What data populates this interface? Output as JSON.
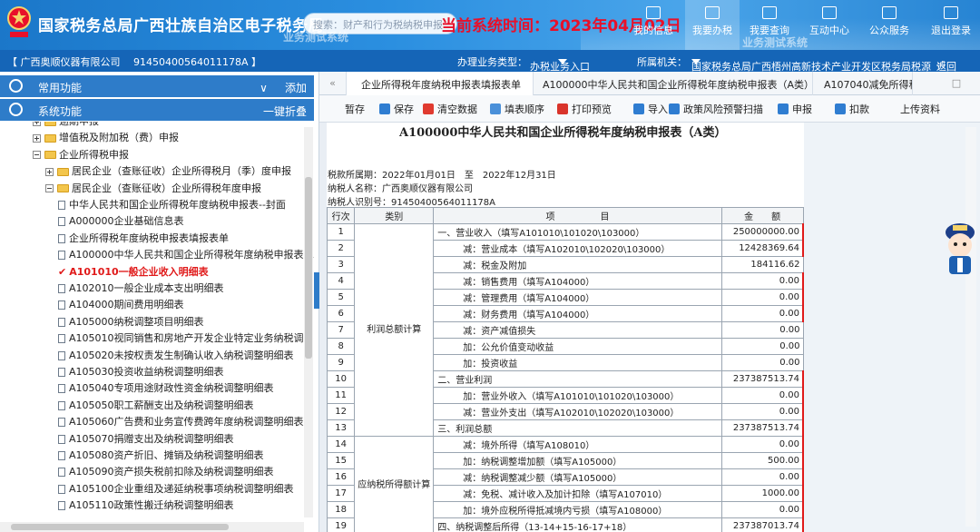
{
  "header": {
    "title": "国家税务总局广西壮族自治区电子税务局",
    "search_placeholder": "搜索：财产和行为税纳税申报",
    "system_time_label": "当前系统时间：2023年04月02日",
    "watermark_1": "业务测试系统",
    "watermark_2": "业务测试系统",
    "nav": [
      {
        "label": "我的信息"
      },
      {
        "label": "我要办税"
      },
      {
        "label": "我要查询"
      },
      {
        "label": "互动中心"
      },
      {
        "label": "公众服务"
      },
      {
        "label": "退出登录"
      }
    ]
  },
  "infobar": {
    "company": "【 广西奥顺仪器有限公司　 91450400564011178A 】",
    "business_type_label": "办理业务类型：",
    "business_type_value": "办税业务入口",
    "tax_office_label": "所属机关：",
    "tax_office_value": "国家税务总局广西梧州高新技术产业开发区税务局税源",
    "back": "返回"
  },
  "sidebar": {
    "common": {
      "label": "常用功能",
      "action": "添加"
    },
    "system": {
      "label": "系统功能",
      "action": "一键折叠"
    },
    "tree": [
      {
        "label": "逾期申报",
        "type": "folder",
        "expand": "plus",
        "indent": 1
      },
      {
        "label": "增值税及附加税（费）申报",
        "type": "folder",
        "expand": "plus",
        "indent": 1
      },
      {
        "label": "企业所得税申报",
        "type": "folder",
        "expand": "minus",
        "indent": 1
      },
      {
        "label": "居民企业（查账征收）企业所得税月（季）度申报",
        "type": "folder",
        "expand": "plus",
        "indent": 2
      },
      {
        "label": "居民企业（查账征收）企业所得税年度申报",
        "type": "folder",
        "expand": "minus",
        "indent": 2
      },
      {
        "label": "中华人民共和国企业所得税年度纳税申报表--封面",
        "type": "doc",
        "indent": 3
      },
      {
        "label": "A000000企业基础信息表",
        "type": "doc",
        "indent": 3
      },
      {
        "label": "企业所得税年度纳税申报表填报表单",
        "type": "doc",
        "indent": 3
      },
      {
        "label": "A100000中华人民共和国企业所得税年度纳税申报表（A",
        "type": "doc",
        "indent": 3
      },
      {
        "label": "A101010一般企业收入明细表",
        "type": "active",
        "indent": 3
      },
      {
        "label": "A102010一般企业成本支出明细表",
        "type": "doc",
        "indent": 3
      },
      {
        "label": "A104000期间费用明细表",
        "type": "doc",
        "indent": 3
      },
      {
        "label": "A105000纳税调整项目明细表",
        "type": "doc",
        "indent": 3
      },
      {
        "label": "A105010视同销售和房地产开发企业特定业务纳税调整明",
        "type": "doc",
        "indent": 3
      },
      {
        "label": "A105020未按权责发生制确认收入纳税调整明细表",
        "type": "doc",
        "indent": 3
      },
      {
        "label": "A105030投资收益纳税调整明细表",
        "type": "doc",
        "indent": 3
      },
      {
        "label": "A105040专项用途财政性资金纳税调整明细表",
        "type": "doc",
        "indent": 3
      },
      {
        "label": "A105050职工薪酬支出及纳税调整明细表",
        "type": "doc",
        "indent": 3
      },
      {
        "label": "A105060广告费和业务宣传费跨年度纳税调整明细表",
        "type": "doc",
        "indent": 3
      },
      {
        "label": "A105070捐赠支出及纳税调整明细表",
        "type": "doc",
        "indent": 3
      },
      {
        "label": "A105080资产折旧、摊销及纳税调整明细表",
        "type": "doc",
        "indent": 3
      },
      {
        "label": "A105090资产损失税前扣除及纳税调整明细表",
        "type": "doc",
        "indent": 3
      },
      {
        "label": "A105100企业重组及递延纳税事项纳税调整明细表",
        "type": "doc",
        "indent": 3
      },
      {
        "label": "A105110政策性搬迁纳税调整明细表",
        "type": "doc",
        "indent": 3
      }
    ]
  },
  "tabs": [
    {
      "label": "企业所得税年度纳税申报表填报表单"
    },
    {
      "label": "A100000中华人民共和国企业所得税年度纳税申报表（A类）"
    },
    {
      "label": "A107040减免所得税"
    }
  ],
  "toolbar": {
    "buttons": [
      {
        "label": "暂存",
        "color": ""
      },
      {
        "label": "保存",
        "color": "#2f7dd1"
      },
      {
        "label": "清空数据",
        "color": "#e03a2f"
      },
      {
        "label": "填表顺序",
        "color": "#4a90d9"
      },
      {
        "label": "打印预览",
        "color": "#d9342b"
      },
      {
        "label": "导入",
        "color": "#2f7dd1"
      },
      {
        "label": "政策风险预警扫描",
        "color": "#2f7dd1"
      },
      {
        "label": "申报",
        "color": "#2f7dd1"
      },
      {
        "label": "扣款",
        "color": "#2f7dd1"
      },
      {
        "label": "上传资料",
        "color": ""
      }
    ]
  },
  "form": {
    "title": "A100000中华人民共和国企业所得税年度纳税申报表（A类）",
    "period": "税款所属期：2022年01月01日　至　2022年12月31日",
    "taxpayer_name": "纳税人名称：广西奥顺仪器有限公司",
    "taxpayer_id": "纳税人识别号：91450400564011178A",
    "headers": {
      "row": "行次",
      "category": "类别",
      "item": "项　　　　　目",
      "amount": "金　　额"
    },
    "category_1": "利润总额计算",
    "category_2": "应纳税所得额计算",
    "rows": [
      {
        "no": "1",
        "item": "一、营业收入（填写A101010\\101020\\103000）",
        "amount": "250000000.00",
        "indent": 0,
        "red": true
      },
      {
        "no": "2",
        "item": "减：营业成本（填写A102010\\102020\\103000）",
        "amount": "12428369.64",
        "indent": 1,
        "red": true
      },
      {
        "no": "3",
        "item": "减：税金及附加",
        "amount": "184116.62",
        "indent": 1,
        "red": false
      },
      {
        "no": "4",
        "item": "减：销售费用（填写A104000）",
        "amount": "0.00",
        "indent": 1,
        "red": true
      },
      {
        "no": "5",
        "item": "减：管理费用（填写A104000）",
        "amount": "0.00",
        "indent": 1,
        "red": true
      },
      {
        "no": "6",
        "item": "减：财务费用（填写A104000）",
        "amount": "0.00",
        "indent": 1,
        "red": true
      },
      {
        "no": "7",
        "item": "减：资产减值损失",
        "amount": "0.00",
        "indent": 1,
        "red": false
      },
      {
        "no": "8",
        "item": "加：公允价值变动收益",
        "amount": "0.00",
        "indent": 1,
        "red": false
      },
      {
        "no": "9",
        "item": "加：投资收益",
        "amount": "0.00",
        "indent": 1,
        "red": false
      },
      {
        "no": "10",
        "item": "二、营业利润",
        "amount": "237387513.74",
        "indent": 0,
        "red": true
      },
      {
        "no": "11",
        "item": "加：营业外收入（填写A101010\\101020\\103000）",
        "amount": "0.00",
        "indent": 1,
        "red": true
      },
      {
        "no": "12",
        "item": "减：营业外支出（填写A102010\\102020\\103000）",
        "amount": "0.00",
        "indent": 1,
        "red": true
      },
      {
        "no": "13",
        "item": "三、利润总额",
        "amount": "237387513.74",
        "indent": 0,
        "red": true
      },
      {
        "no": "14",
        "item": "减：境外所得（填写A108010）",
        "amount": "0.00",
        "indent": 1,
        "red": true
      },
      {
        "no": "15",
        "item": "加：纳税调整增加额（填写A105000）",
        "amount": "500.00",
        "indent": 1,
        "red": true
      },
      {
        "no": "16",
        "item": "减：纳税调整减少额（填写A105000）",
        "amount": "0.00",
        "indent": 1,
        "red": true
      },
      {
        "no": "17",
        "item": "减：免税、减计收入及加计扣除（填写A107010）",
        "amount": "1000.00",
        "indent": 1,
        "red": true
      },
      {
        "no": "18",
        "item": "加：境外应税所得抵减境内亏损（填写A108000）",
        "amount": "0.00",
        "indent": 1,
        "red": true
      },
      {
        "no": "19",
        "item": "四、纳税调整后所得（13-14+15-16-17+18）",
        "amount": "237387013.74",
        "indent": 0,
        "red": true
      }
    ]
  }
}
